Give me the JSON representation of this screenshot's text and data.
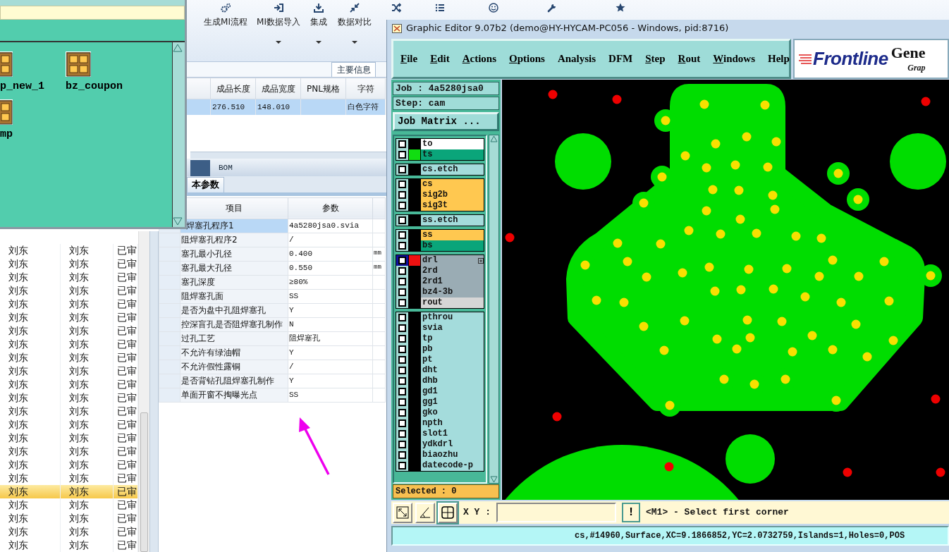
{
  "ribbon": {
    "buttons": [
      {
        "label": "生成MI流程",
        "dropdown": false
      },
      {
        "label": "MI数据导入",
        "dropdown": true
      },
      {
        "label": "集成",
        "dropdown": true
      },
      {
        "label": "数据对比",
        "dropdown": true
      }
    ]
  },
  "job_window": {
    "items": [
      {
        "label": "p_new_1"
      },
      {
        "label": "bz_coupon"
      },
      {
        "label": "mp"
      }
    ]
  },
  "left_list": {
    "rows": [
      {
        "cells": [
          "刘东",
          "刘东",
          "已审"
        ],
        "selected": false
      },
      {
        "cells": [
          "刘东",
          "刘东",
          "已审"
        ],
        "selected": false
      },
      {
        "cells": [
          "刘东",
          "刘东",
          "已审"
        ],
        "selected": false
      },
      {
        "cells": [
          "刘东",
          "刘东",
          "已审"
        ],
        "selected": false
      },
      {
        "cells": [
          "刘东",
          "刘东",
          "已审"
        ],
        "selected": false
      },
      {
        "cells": [
          "刘东",
          "刘东",
          "已审"
        ],
        "selected": false
      },
      {
        "cells": [
          "刘东",
          "刘东",
          "已审"
        ],
        "selected": false
      },
      {
        "cells": [
          "刘东",
          "刘东",
          "已审"
        ],
        "selected": false
      },
      {
        "cells": [
          "刘东",
          "刘东",
          "已审"
        ],
        "selected": false
      },
      {
        "cells": [
          "刘东",
          "刘东",
          "已审"
        ],
        "selected": false
      },
      {
        "cells": [
          "刘东",
          "刘东",
          "已审"
        ],
        "selected": false
      },
      {
        "cells": [
          "刘东",
          "刘东",
          "已审"
        ],
        "selected": false
      },
      {
        "cells": [
          "刘东",
          "刘东",
          "已审"
        ],
        "selected": false
      },
      {
        "cells": [
          "刘东",
          "刘东",
          "已审"
        ],
        "selected": false
      },
      {
        "cells": [
          "刘东",
          "刘东",
          "已审"
        ],
        "selected": false
      },
      {
        "cells": [
          "刘东",
          "刘东",
          "已审"
        ],
        "selected": false
      },
      {
        "cells": [
          "刘东",
          "刘东",
          "已审"
        ],
        "selected": false
      },
      {
        "cells": [
          "刘东",
          "刘东",
          "已审"
        ],
        "selected": false
      },
      {
        "cells": [
          "刘东",
          "刘东",
          "已审"
        ],
        "selected": true
      },
      {
        "cells": [
          "刘东",
          "刘东",
          "已审"
        ],
        "selected": false
      },
      {
        "cells": [
          "刘东",
          "刘东",
          "已审"
        ],
        "selected": false
      },
      {
        "cells": [
          "刘东",
          "刘东",
          "已审"
        ],
        "selected": false
      },
      {
        "cells": [
          "刘东",
          "刘东",
          "已审"
        ],
        "selected": false
      }
    ]
  },
  "info_tab": {
    "label": "主要信息"
  },
  "top_table": {
    "columns": [
      "成品长度",
      "成品宽度",
      "PNL规格",
      "字符"
    ],
    "rows": [
      {
        "cells": [
          "276.510",
          "148.010",
          null,
          "白色字符"
        ],
        "selected": true
      }
    ]
  },
  "detail_tabs": [
    {
      "selected": true
    },
    {
      "label": "BOM",
      "selected": false
    }
  ],
  "sub_tabs": [
    {
      "label": "本参数",
      "selected": true
    }
  ],
  "params": {
    "columns": [
      "项目",
      "参数"
    ],
    "rows": [
      {
        "item": "焊塞孔程序1",
        "value": "4a5280jsa0.svia",
        "selected": true
      },
      {
        "item": "阻焊塞孔程序2",
        "value": "/",
        "selected": false
      },
      {
        "item": "塞孔最小孔径",
        "value": "0.400",
        "unit": "mm",
        "selected": false
      },
      {
        "item": "塞孔最大孔径",
        "value": "0.550",
        "unit": "mm",
        "selected": false
      },
      {
        "item": "塞孔深度",
        "value": "≥80%",
        "selected": false
      },
      {
        "item": "阻焊塞孔面",
        "value": "SS",
        "selected": false
      },
      {
        "item": "是否为盘中孔阻焊塞孔",
        "value": "Y",
        "selected": false
      },
      {
        "item": "控深盲孔是否阻焊塞孔制作",
        "value": "N",
        "selected": false
      },
      {
        "item": "过孔工艺",
        "value": "阻焊塞孔",
        "selected": false
      },
      {
        "item": "不允许有绿油帽",
        "value": "Y",
        "selected": false
      },
      {
        "item": "不允许假性露铜",
        "value": "/",
        "selected": false
      },
      {
        "item": "是否背钻孔阻焊塞孔制作",
        "value": "Y",
        "selected": false
      },
      {
        "item": "单面开窗不掏曝光点",
        "value": "SS",
        "selected": false
      }
    ]
  },
  "editor": {
    "title": "Graphic Editor 9.07b2 (demo@HY-HYCAM-PC056 - Windows, pid:8716)",
    "menu": [
      {
        "label": "File",
        "mnemonic": true
      },
      {
        "label": "Edit",
        "mnemonic": true
      },
      {
        "label": "Actions",
        "mnemonic": true
      },
      {
        "label": "Options",
        "mnemonic": true
      },
      {
        "label": "Analysis",
        "mnemonic": false
      },
      {
        "label": "DFM",
        "mnemonic": false
      },
      {
        "label": "Step",
        "mnemonic": true
      },
      {
        "label": "Rout",
        "mnemonic": true
      },
      {
        "label": "Windows",
        "mnemonic": true
      },
      {
        "label": "Help",
        "mnemonic": false
      }
    ],
    "logo": {
      "brand": "Frontline",
      "product": "Gene",
      "subtitle": "Grap"
    },
    "job": "Job : 4a5280jsa0",
    "step": "Step: cam",
    "matrix_button": "Job Matrix ...",
    "layer_groups": [
      {
        "layers": [
          {
            "name": "to",
            "color": "#ffffff",
            "selected": false
          },
          {
            "name": "ts",
            "color": "#0aa57a",
            "display": {
              "color": "#11dd11"
            },
            "selected": false
          }
        ]
      },
      {
        "layers": [
          {
            "name": "cs.etch",
            "color": "#a4dcdc",
            "selected": false
          }
        ]
      },
      {
        "layers": [
          {
            "name": "cs",
            "color": "#ffc850",
            "selected": false
          },
          {
            "name": "sig2b",
            "color": "#ffc850",
            "selected": false
          },
          {
            "name": "sig3t",
            "color": "#ffc850",
            "selected": false
          }
        ]
      },
      {
        "layers": [
          {
            "name": "ss.etch",
            "color": "#a4dcdc",
            "selected": false
          }
        ]
      },
      {
        "layers": [
          {
            "name": "ss",
            "color": "#ffc850",
            "selected": false
          },
          {
            "name": "bs",
            "color": "#0aa57a",
            "selected": false
          }
        ]
      },
      {
        "layers": [
          {
            "name": "drl",
            "color": "#9aacb4",
            "display": {
              "color": "#ee1111"
            },
            "selected": true,
            "expandable": true
          },
          {
            "name": "2rd",
            "color": "#9aacb4",
            "selected": false
          },
          {
            "name": "2rd1",
            "color": "#9aacb4",
            "selected": false
          },
          {
            "name": "bz4-3b",
            "color": "#9aacb4",
            "selected": false
          },
          {
            "name": "rout",
            "color": "#d6d6d6",
            "selected": false
          }
        ]
      },
      {
        "layers": [
          {
            "name": "pthrou",
            "color": "#a4dcdc",
            "selected": false
          },
          {
            "name": "svia",
            "color": "#a4dcdc",
            "selected": false
          },
          {
            "name": "tp",
            "color": "#a4dcdc",
            "selected": false
          },
          {
            "name": "pb",
            "color": "#a4dcdc",
            "selected": false
          },
          {
            "name": "pt",
            "color": "#a4dcdc",
            "selected": false
          },
          {
            "name": "dht",
            "color": "#a4dcdc",
            "selected": false
          },
          {
            "name": "dhb",
            "color": "#a4dcdc",
            "selected": false
          },
          {
            "name": "gd1",
            "color": "#a4dcdc",
            "selected": false
          },
          {
            "name": "gg1",
            "color": "#a4dcdc",
            "selected": false
          },
          {
            "name": "gko",
            "color": "#a4dcdc",
            "selected": false
          },
          {
            "name": "npth",
            "color": "#a4dcdc",
            "selected": false
          },
          {
            "name": "slot1",
            "color": "#a4dcdc",
            "selected": false
          },
          {
            "name": "ydkdrl",
            "color": "#a4dcdc",
            "selected": false
          },
          {
            "name": "biaozhu",
            "color": "#a4dcdc",
            "selected": false
          },
          {
            "name": "datecode-p",
            "color": "#a4dcdc",
            "selected": false
          }
        ]
      }
    ],
    "selected_count": "Selected : 0",
    "xy_label": "X Y :",
    "alert_button": "!",
    "message": "<M1> - Select first corner",
    "status": "cs,#14960,Surface,XC=9.1866852,YC=2.0732759,Islands=1,Holes=0,POS"
  }
}
